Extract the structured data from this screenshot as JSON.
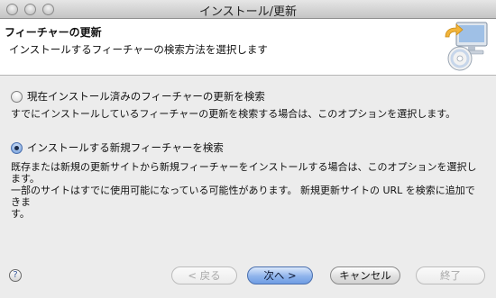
{
  "window": {
    "title": "インストール/更新"
  },
  "header": {
    "title": "フィーチャーの更新",
    "description": "インストールするフィーチャーの検索方法を選択します"
  },
  "options": [
    {
      "label": "現在インストール済みのフィーチャーの更新を検索",
      "selected": false,
      "description": "すでにインストールしているフィーチャーの更新を検索する場合は、このオプションを選択します。"
    },
    {
      "label": "インストールする新規フィーチャーを検索",
      "selected": true,
      "description_line1": "既存または新規の更新サイトから新規フィーチャーをインストールする場合は、このオプションを選択します。",
      "description_line2": "一部のサイトはすでに使用可能になっている可能性があります。 新規更新サイトの URL を検索に追加できま",
      "description_line3": "す。"
    }
  ],
  "footer": {
    "help_glyph": "?",
    "back_label": "< 戻る",
    "next_label": "次へ >",
    "cancel_label": "キャンセル",
    "finish_label": "終了"
  },
  "colors": {
    "primary_button": "#6f9de4",
    "window_bg": "#ececec",
    "header_bg": "#ffffff"
  },
  "icons": {
    "header_graphic": "install-update-wizard-icon",
    "help": "help-icon"
  }
}
